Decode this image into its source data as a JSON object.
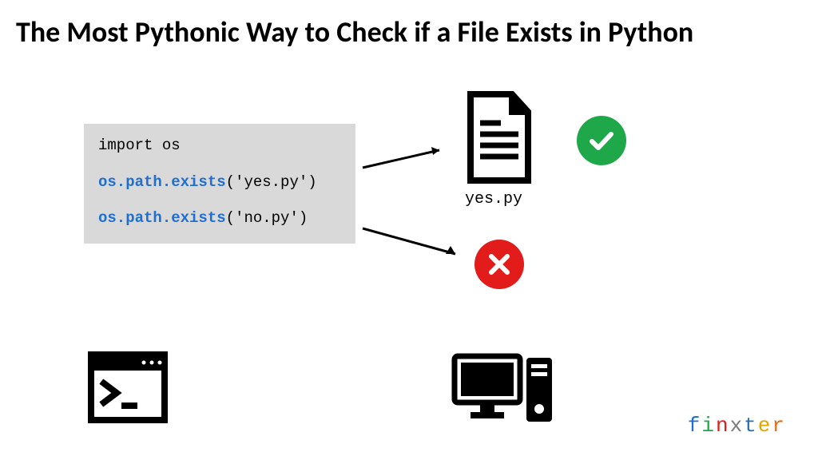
{
  "title": "The Most Pythonic Way to Check if a File Exists in Python",
  "code": {
    "line1_prefix": "import",
    "line1_module": " os",
    "line2_obj": "os.path.exists",
    "line2_arg": "('yes.py')",
    "line3_obj": "os.path.exists",
    "line3_arg": "('no.py')"
  },
  "file_label": "yes.py",
  "brand": {
    "chars": [
      "f",
      "i",
      "n",
      "x",
      "t",
      "e",
      "r"
    ],
    "colors": [
      "#1f6fd1",
      "#1ea84a",
      "#e21b1b",
      "#7b7b7b",
      "#2b6fb3",
      "#e0a400",
      "#e86b1c"
    ]
  }
}
